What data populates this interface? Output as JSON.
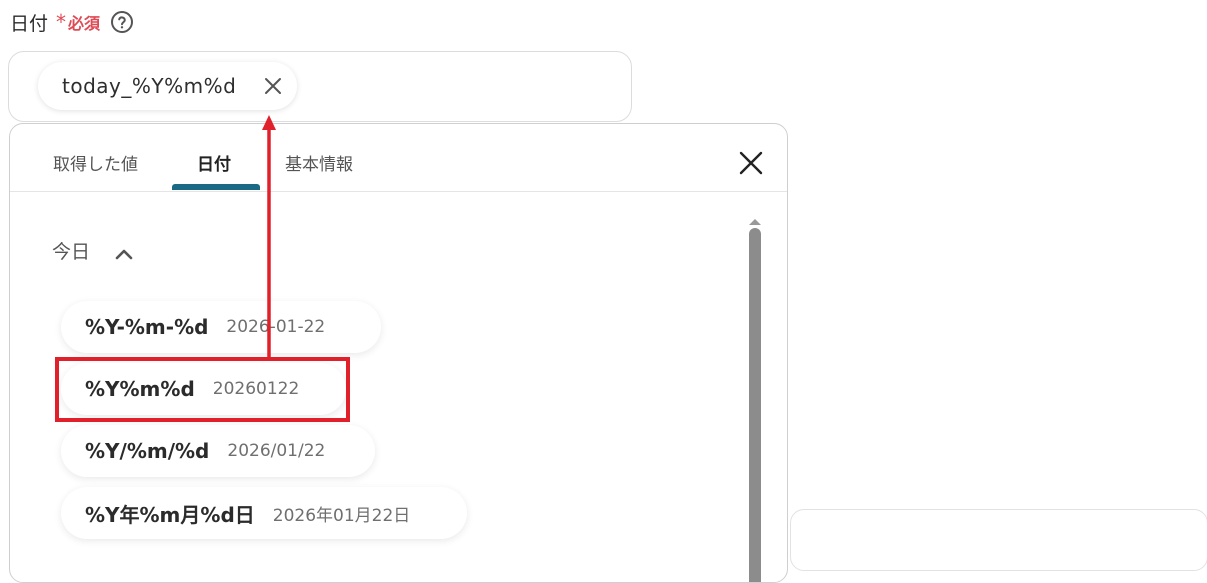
{
  "field": {
    "label": "日付",
    "required_mark": "*",
    "required_text": "必須",
    "help_icon": "question-circle-icon"
  },
  "value_chip": {
    "label": "today_%Y%m%d",
    "remove_icon": "close-icon"
  },
  "panel": {
    "tabs": [
      {
        "label": "取得した値",
        "active": false
      },
      {
        "label": "日付",
        "active": true
      },
      {
        "label": "基本情報",
        "active": false
      }
    ],
    "close_icon": "close-icon",
    "section": {
      "title": "今日",
      "toggle_icon": "chevron-up-icon",
      "options": [
        {
          "code": "%Y-%m-%d",
          "sample": "2026-01-22"
        },
        {
          "code": "%Y%m%d",
          "sample": "20260122",
          "highlighted": true
        },
        {
          "code": "%Y/%m/%d",
          "sample": "2026/01/22"
        },
        {
          "code": "%Y年%m月%d日",
          "sample": "2026年01月22日"
        }
      ]
    }
  },
  "colors": {
    "required": "#e04a55",
    "tab_indicator": "#1a6a86",
    "annotation": "#e0202a"
  }
}
